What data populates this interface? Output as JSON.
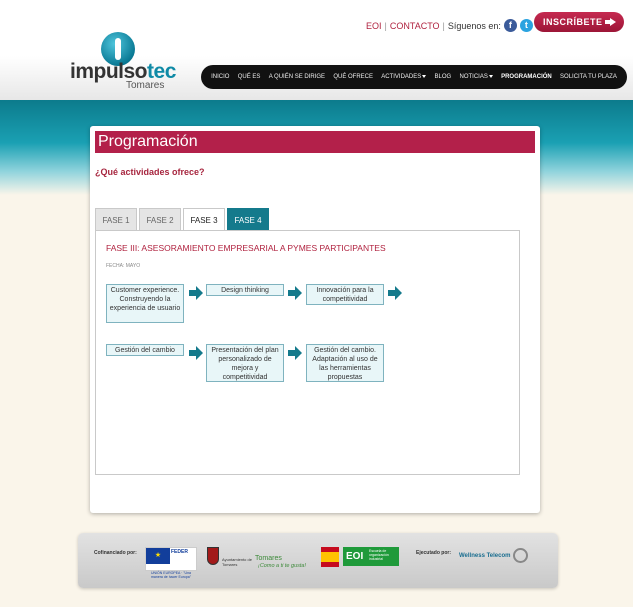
{
  "brand": {
    "name_prefix": "impulso",
    "name_accent": "tec",
    "sub": "Tomares"
  },
  "toplinks": {
    "eoi": "EOI",
    "contacto": "CONTACTO",
    "siguenos": "Síguenos en:",
    "fb": "f",
    "tw": "t"
  },
  "cta": {
    "label": "INSCRÍBETE"
  },
  "nav": [
    {
      "label": "INICIO"
    },
    {
      "label": "QUÉ ES"
    },
    {
      "label": "A QUIÉN SE DIRIGE"
    },
    {
      "label": "QUÉ OFRECE"
    },
    {
      "label": "ACTIVIDADES"
    },
    {
      "label": "BLOG"
    },
    {
      "label": "NOTICIAS"
    },
    {
      "label": "PROGRAMACIÓN"
    },
    {
      "label": "SOLICITA TU PLAZA"
    }
  ],
  "page": {
    "title": "Programación",
    "question": "¿Qué actividades ofrece?"
  },
  "tabs": [
    {
      "label": "FASE 1"
    },
    {
      "label": "FASE 2"
    },
    {
      "label": "FASE 3"
    },
    {
      "label": "FASE 4"
    }
  ],
  "phase": {
    "title": "FASE III: ASESORAMIENTO EMPRESARIAL A PYMES PARTICIPANTES",
    "date": "FECHA: MAYO",
    "steps_row1": [
      "Customer experience. Construyendo la experiencia de usuario",
      "Design thinking",
      "Innovación para la competitividad"
    ],
    "steps_row2": [
      "Gestión del cambio",
      "Presentación del plan personalizado de mejora y competitividad",
      "Gestión del cambio. Adaptación al uso de las herramientas propuestas"
    ]
  },
  "footer": {
    "cofinanciado": "Cofinanciado por:",
    "feder": "FEDER",
    "ue_caption": "UNIÓN EUROPEA · \"Una manera de hacer Europa\"",
    "ayuntamiento": "Ayuntamiento de Tomares",
    "tomares": "Tomares",
    "tomares_tag": "¡Como a ti te gusta!",
    "eoi": "EOI",
    "eoi_sub": "Escuela de organización industrial",
    "ejecutado": "Ejecutado por:",
    "wellness": "Wellness Telecom"
  }
}
